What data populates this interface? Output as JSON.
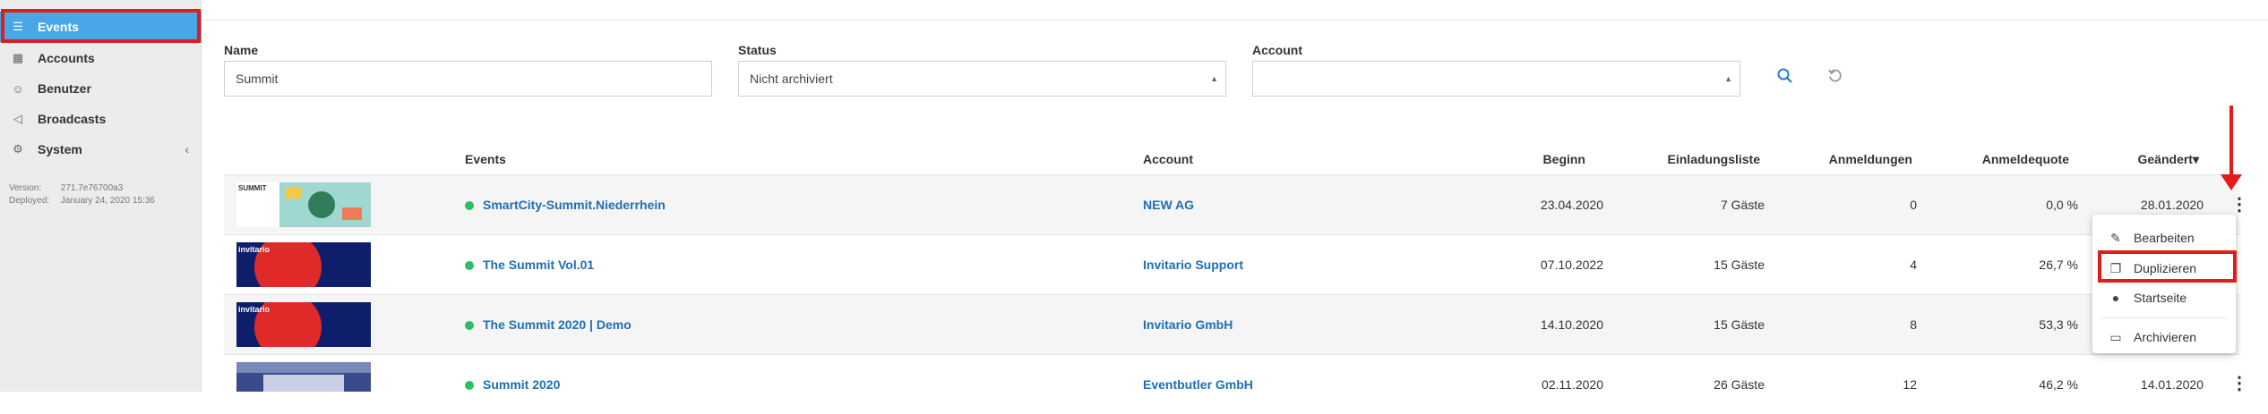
{
  "sidebar": {
    "items": [
      {
        "label": "Events",
        "icon": "list-icon"
      },
      {
        "label": "Accounts",
        "icon": "building-icon"
      },
      {
        "label": "Benutzer",
        "icon": "users-icon"
      },
      {
        "label": "Broadcasts",
        "icon": "megaphone-icon"
      },
      {
        "label": "System",
        "icon": "gears-icon"
      }
    ],
    "version_label": "Version:",
    "version_value": "271.7e76700a3",
    "deployed_label": "Deployed:",
    "deployed_value": "January 24, 2020 15:36"
  },
  "filters": {
    "name_label": "Name",
    "name_value": "Summit",
    "status_label": "Status",
    "status_value": "Nicht archiviert",
    "account_label": "Account",
    "account_value": ""
  },
  "table": {
    "headers": {
      "events": "Events",
      "account": "Account",
      "beginn": "Beginn",
      "einladungsliste": "Einladungsliste",
      "anmeldungen": "Anmeldungen",
      "anmeldequote": "Anmeldequote",
      "geaendert": "Geändert▾"
    },
    "rows": [
      {
        "event": "SmartCity-Summit.Niederrhein",
        "account": "NEW AG",
        "beginn": "23.04.2020",
        "einladungsliste": "7 Gäste",
        "anmeldungen": "0",
        "anmeldequote": "0,0 %",
        "geaendert": "28.01.2020"
      },
      {
        "event": "The Summit Vol.01",
        "account": "Invitario Support",
        "beginn": "07.10.2022",
        "einladungsliste": "15 Gäste",
        "anmeldungen": "4",
        "anmeldequote": "26,7 %",
        "geaendert": ""
      },
      {
        "event": "The Summit 2020 | Demo",
        "account": "Invitario GmbH",
        "beginn": "14.10.2020",
        "einladungsliste": "15 Gäste",
        "anmeldungen": "8",
        "anmeldequote": "53,3 %",
        "geaendert": ""
      },
      {
        "event": "Summit 2020",
        "account": "Eventbutler GmbH",
        "beginn": "02.11.2020",
        "einladungsliste": "26 Gäste",
        "anmeldungen": "12",
        "anmeldequote": "46,2 %",
        "geaendert": "14.01.2020"
      }
    ]
  },
  "menu": {
    "items": [
      {
        "label": "Bearbeiten",
        "icon": "pencil-icon"
      },
      {
        "label": "Duplizieren",
        "icon": "copy-icon"
      },
      {
        "label": "Startseite",
        "icon": "globe-icon"
      },
      {
        "label": "Archivieren",
        "icon": "archive-icon"
      }
    ]
  },
  "colors": {
    "accent": "#4aa6e6",
    "link": "#1f6fb2",
    "highlight": "#e21b1b",
    "status_active": "#2bbf6a"
  }
}
